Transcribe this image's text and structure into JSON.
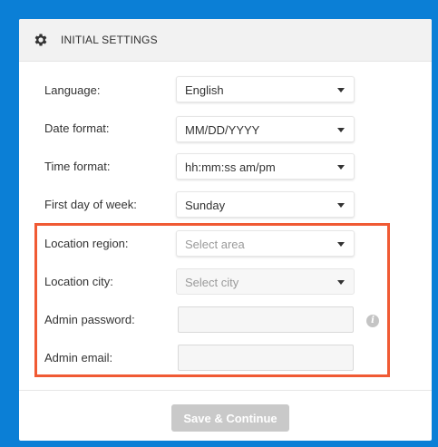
{
  "panel": {
    "title": "INITIAL SETTINGS",
    "header_icon": "gear-icon"
  },
  "fields": {
    "language": {
      "label": "Language:",
      "value": "English"
    },
    "date_format": {
      "label": "Date format:",
      "value": "MM/DD/YYYY"
    },
    "time_format": {
      "label": "Time format:",
      "value": "hh:mm:ss am/pm"
    },
    "first_day": {
      "label": "First day of week:",
      "value": "Sunday"
    },
    "location_region": {
      "label": "Location region:",
      "placeholder": "Select area"
    },
    "location_city": {
      "label": "Location city:",
      "placeholder": "Select city"
    },
    "admin_password": {
      "label": "Admin password:",
      "value": ""
    },
    "admin_email": {
      "label": "Admin email:",
      "value": ""
    }
  },
  "info_icon_glyph": "i",
  "footer": {
    "save_label": "Save & Continue"
  },
  "colors": {
    "background": "#0b7fd6",
    "highlight": "#f05a34",
    "button_disabled": "#c9c9c9"
  }
}
